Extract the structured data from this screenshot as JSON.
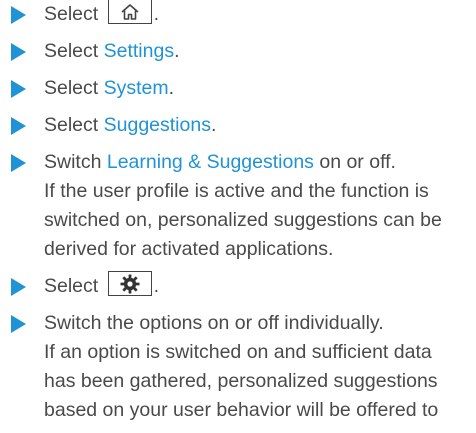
{
  "accent_color": "#1f93d5",
  "steps": [
    {
      "prefix": "Select",
      "icon": "home-icon",
      "suffix": "."
    },
    {
      "prefix": "Select ",
      "link": "Settings",
      "suffix": "."
    },
    {
      "prefix": "Select ",
      "link": "System",
      "suffix": "."
    },
    {
      "prefix": "Select ",
      "link": "Suggestions",
      "suffix": "."
    },
    {
      "prefix": "Switch ",
      "link": "Learning & Suggestions",
      "suffix": " on or off.",
      "note_lines": [
        "If the user profile is active and the function is",
        "switched on, personalized suggestions can be",
        "derived for activated applications."
      ]
    },
    {
      "prefix": "Select",
      "icon": "gear-icon",
      "suffix": "."
    },
    {
      "text": "Switch the options on or off individually.",
      "note_lines": [
        "If an option is switched on and sufficient data",
        "has been gathered, personalized suggestions",
        "based on your user behavior will be offered to"
      ]
    }
  ]
}
